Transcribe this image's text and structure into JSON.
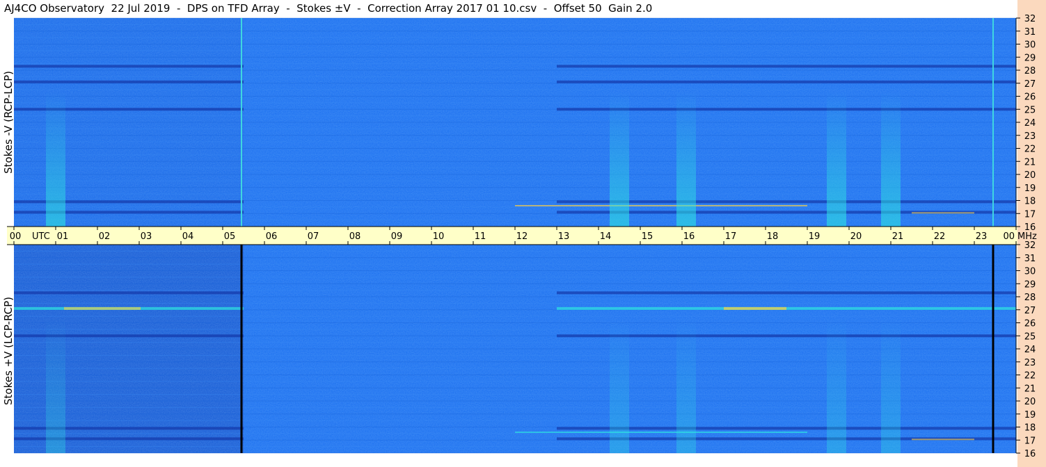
{
  "window": {
    "title": "AJ4CO Observatory  22 Jul 2019  -  DPS on TFD Array  -  Stokes ±V  -  Correction Array 2017 01 10.csv  -  Offset 50  Gain 2.0"
  },
  "chart_data": {
    "type": "heatmap",
    "panels": [
      {
        "ylabel": "Stokes -V (RCP-LCP)",
        "y_unit": "MHz",
        "ylim": [
          16,
          32
        ],
        "yticks": [
          "32",
          "31",
          "30",
          "29",
          "28",
          "27",
          "26",
          "25",
          "24",
          "23",
          "22",
          "21",
          "20",
          "19",
          "18",
          "17",
          "16"
        ],
        "marker_hours": [
          5.45,
          23.45
        ],
        "marker_color": "#3fd6e0",
        "rfi_bands_mhz": [
          27.1,
          28.3,
          25.0,
          17.9,
          17.1
        ],
        "background_color": "#1a6ff0"
      },
      {
        "ylabel": "Stokes +V (LCP-RCP)",
        "y_unit": "MHz",
        "ylim": [
          16,
          32
        ],
        "yticks": [
          "32",
          "31",
          "30",
          "29",
          "28",
          "27",
          "26",
          "25",
          "24",
          "23",
          "22",
          "21",
          "20",
          "19",
          "18",
          "17",
          "16"
        ],
        "marker_hours": [
          5.45,
          23.45
        ],
        "marker_color": "#000000",
        "rfi_bands_mhz": [
          27.1,
          28.3,
          25.0,
          17.9,
          17.1
        ],
        "background_color": "#1a6ff0"
      }
    ],
    "x_axis": {
      "label": "UTC",
      "range_hours": [
        0,
        24
      ],
      "ticks": [
        "00",
        "01",
        "02",
        "03",
        "04",
        "05",
        "06",
        "07",
        "08",
        "09",
        "10",
        "11",
        "12",
        "13",
        "14",
        "15",
        "16",
        "17",
        "18",
        "19",
        "20",
        "21",
        "22",
        "23",
        "00"
      ],
      "unit_label": "MHz"
    },
    "colors": {
      "axis_strip": "#ffffc8",
      "right_strip": "#fbd9be",
      "low": "#1438a8",
      "mid": "#1a6ff0",
      "high": "#2ee6e0",
      "peak": "#ffd040"
    }
  }
}
